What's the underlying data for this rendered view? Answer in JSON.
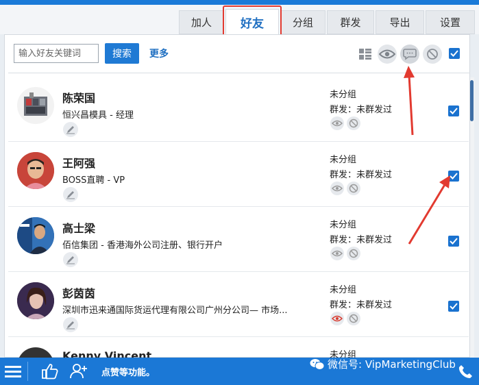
{
  "tabs": [
    "加人",
    "好友",
    "分组",
    "群发",
    "导出",
    "设置"
  ],
  "active_tab": "好友",
  "search": {
    "placeholder": "输入好友关键词",
    "button": "搜索",
    "more": "更多"
  },
  "toolbar_icons": [
    "grid-icon",
    "eye-icon",
    "chat-bubble-icon",
    "block-icon"
  ],
  "contacts": [
    {
      "name": "陈荣国",
      "company": "恒兴昌模具 - 经理",
      "group": "未分组",
      "mass_send": "群发：未群发过",
      "eye_color": "#9a9a9a",
      "checked": true
    },
    {
      "name": "王阿强",
      "company": "BOSS直聘 - VP",
      "group": "未分组",
      "mass_send": "群发：未群发过",
      "eye_color": "#9a9a9a",
      "checked": true
    },
    {
      "name": "高士梁",
      "company": "佰信集团 - 香港海外公司注册、银行开户",
      "group": "未分组",
      "mass_send": "群发：未群发过",
      "eye_color": "#9a9a9a",
      "checked": true
    },
    {
      "name": "彭茵茵",
      "company": "深圳市迅来通国际货运代理有限公司广州分公司— 市场...",
      "group": "未分组",
      "mass_send": "群发：未群发过",
      "eye_color": "#d83a2e",
      "checked": true
    },
    {
      "name": "Kenny Vincent",
      "company": "",
      "group": "未分组",
      "mass_send": "",
      "eye_color": "#9a9a9a",
      "checked": false
    }
  ],
  "bottom_bar": {
    "text": "点赞等功能。",
    "watermark": "微信号: VipMarketingClub"
  },
  "colors": {
    "accent": "#1b78d6",
    "highlight": "#e23a30"
  }
}
